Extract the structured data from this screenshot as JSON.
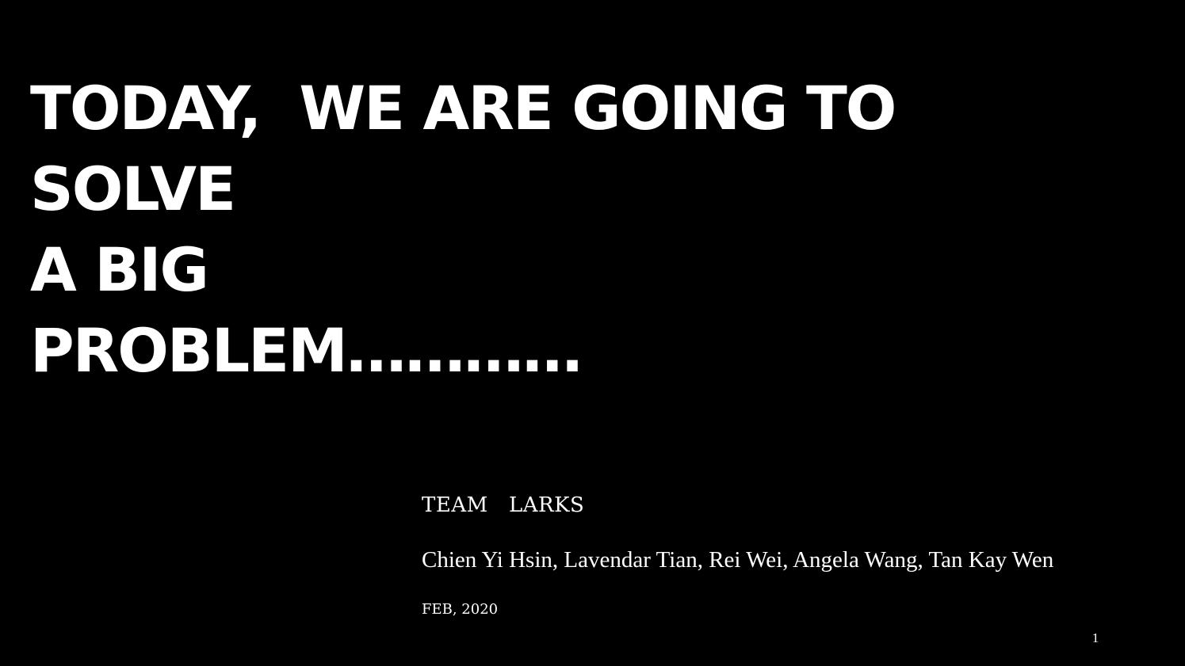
{
  "slide": {
    "background_color": "#000000",
    "text_color": "#ffffff",
    "title_lines": [
      "TODAY,  WE ARE GOING TO",
      "SOLVE",
      "A BIG",
      "PROBLEM…………"
    ],
    "team": "TEAM   LARKS",
    "members": "Chien Yi Hsin, Lavendar Tian, Rei Wei, Angela Wang, Tan Kay Wen",
    "date": "FEB, 2020",
    "page_number": "1"
  }
}
